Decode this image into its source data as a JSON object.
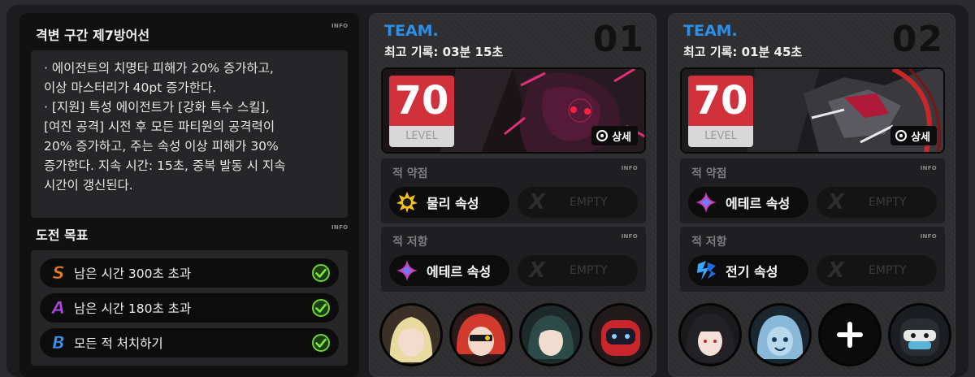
{
  "stage": {
    "title": "격변 구간 제7방어선",
    "info_tag": "INFO",
    "description": [
      "· 에이전트의 치명타 피해가 20% 증가하고,",
      "이상 마스터리가 40pt 증가한다.",
      "· [지원] 특성 에이전트가 [강화 특수 스킬],",
      "[여진 공격] 시전 후 모든 파티원의 공격력이",
      "20% 증가하고, 주는 속성 이상 피해가 30%",
      "증가한다. 지속 시간: 15초, 중복 발동 시 지속",
      "시간이 갱신된다."
    ]
  },
  "goals": {
    "title": "도전 목표",
    "info_tag": "INFO",
    "items": [
      {
        "grade": "S",
        "label": "남은 시간 300초 초과",
        "color": "#f0801e",
        "done": true
      },
      {
        "grade": "A",
        "label": "남은 시간 180초 초과",
        "color": "#b04be8",
        "done": true
      },
      {
        "grade": "B",
        "label": "모든 적 처치하기",
        "color": "#3a96ef",
        "done": true
      }
    ]
  },
  "teams": [
    {
      "label": "TEAM.",
      "number": "01",
      "record": "최고 기록: 03분 15초",
      "level": "70",
      "level_label": "LEVEL",
      "detail_label": "상세",
      "weak_title": "적 약점",
      "resist_title": "적 저항",
      "info_tag": "INFO",
      "weakness": {
        "label": "물리 속성",
        "icon": "physical-icon"
      },
      "weakness_empty": "EMPTY",
      "resistance": {
        "label": "에테르 속성",
        "icon": "ether-icon"
      },
      "resistance_empty": "EMPTY",
      "members": [
        "agent-blonde-avatar",
        "agent-red-avatar",
        "agent-teal-avatar",
        "agent-bangboo-red-avatar"
      ]
    },
    {
      "label": "TEAM.",
      "number": "02",
      "record": "최고 기록: 01분 45초",
      "level": "70",
      "level_label": "LEVEL",
      "detail_label": "상세",
      "weak_title": "적 약점",
      "resist_title": "적 저항",
      "info_tag": "INFO",
      "weakness": {
        "label": "에테르 속성",
        "icon": "ether-icon"
      },
      "weakness_empty": "EMPTY",
      "resistance": {
        "label": "전기 속성",
        "icon": "electric-icon"
      },
      "resistance_empty": "EMPTY",
      "members": [
        "agent-dark-hair-avatar",
        "agent-blue-avatar",
        "add-member",
        "agent-bangboo-black-avatar"
      ]
    }
  ]
}
